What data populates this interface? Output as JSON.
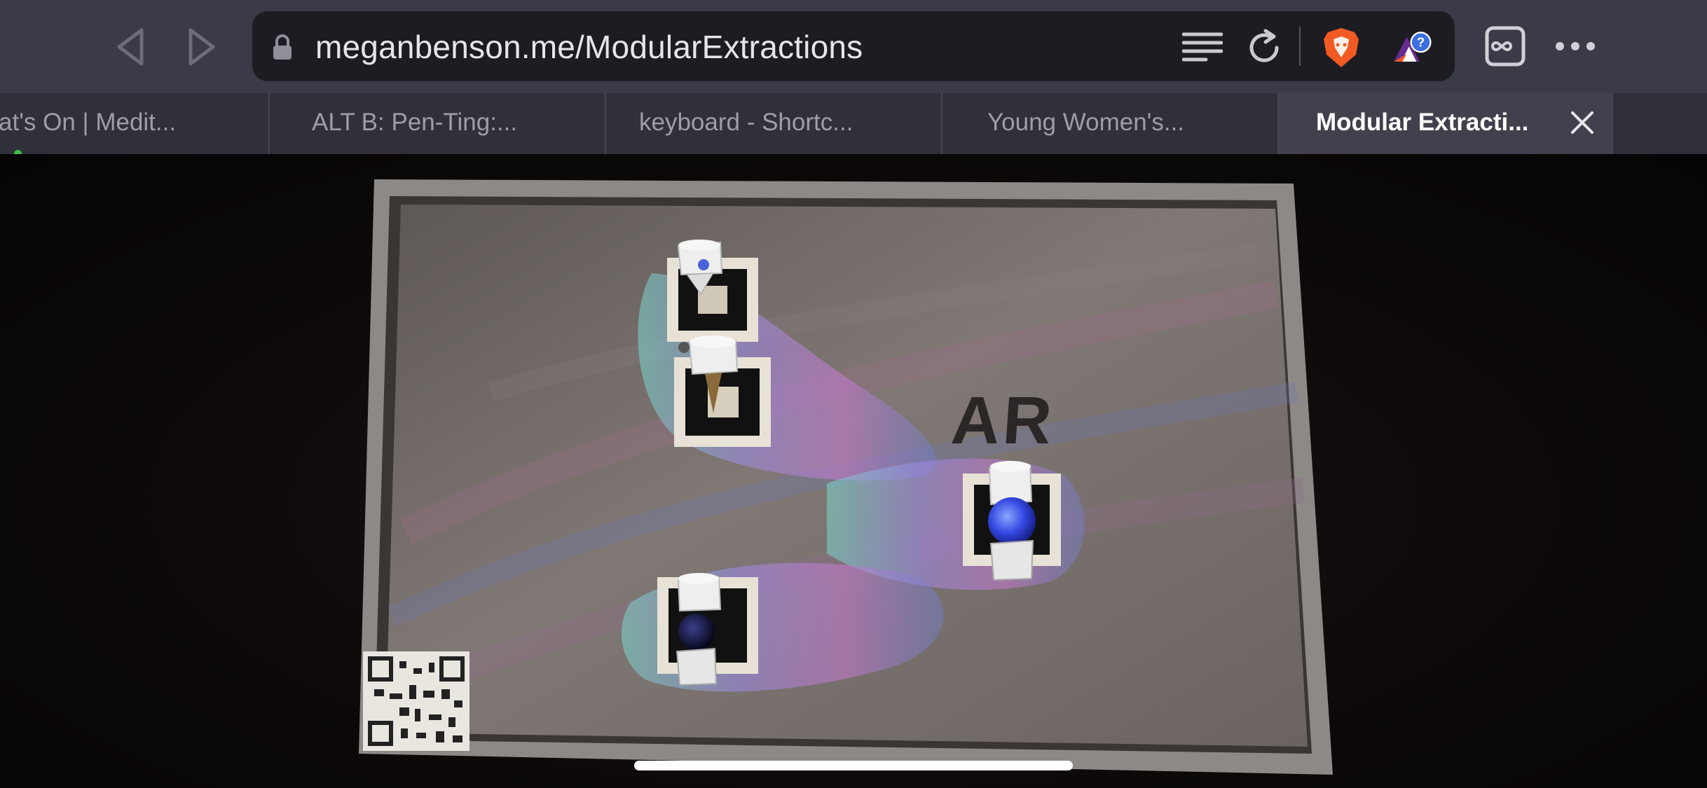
{
  "browser": {
    "url": "meganbenson.me/ModularExtractions",
    "tabs": [
      {
        "title": "at's On | Medit...",
        "active": false
      },
      {
        "title": "ALT B: Pen-Ting:...",
        "active": false
      },
      {
        "title": "keyboard - Shortc...",
        "active": false
      },
      {
        "title": "Young Women's...",
        "active": false
      },
      {
        "title": "Modular Extracti...",
        "active": true
      }
    ],
    "brave_rewards_badge": "?"
  },
  "scene": {
    "sign_text": "AR",
    "qr_code": "qr-code"
  },
  "colors": {
    "toolbar": "#3a3b46",
    "url_bar": "#1c1c22",
    "tabstrip": "#2f3039",
    "active_tab": "#40414c",
    "brave_orange": "#f15a22",
    "rewards_blue": "#3b6fe0"
  }
}
